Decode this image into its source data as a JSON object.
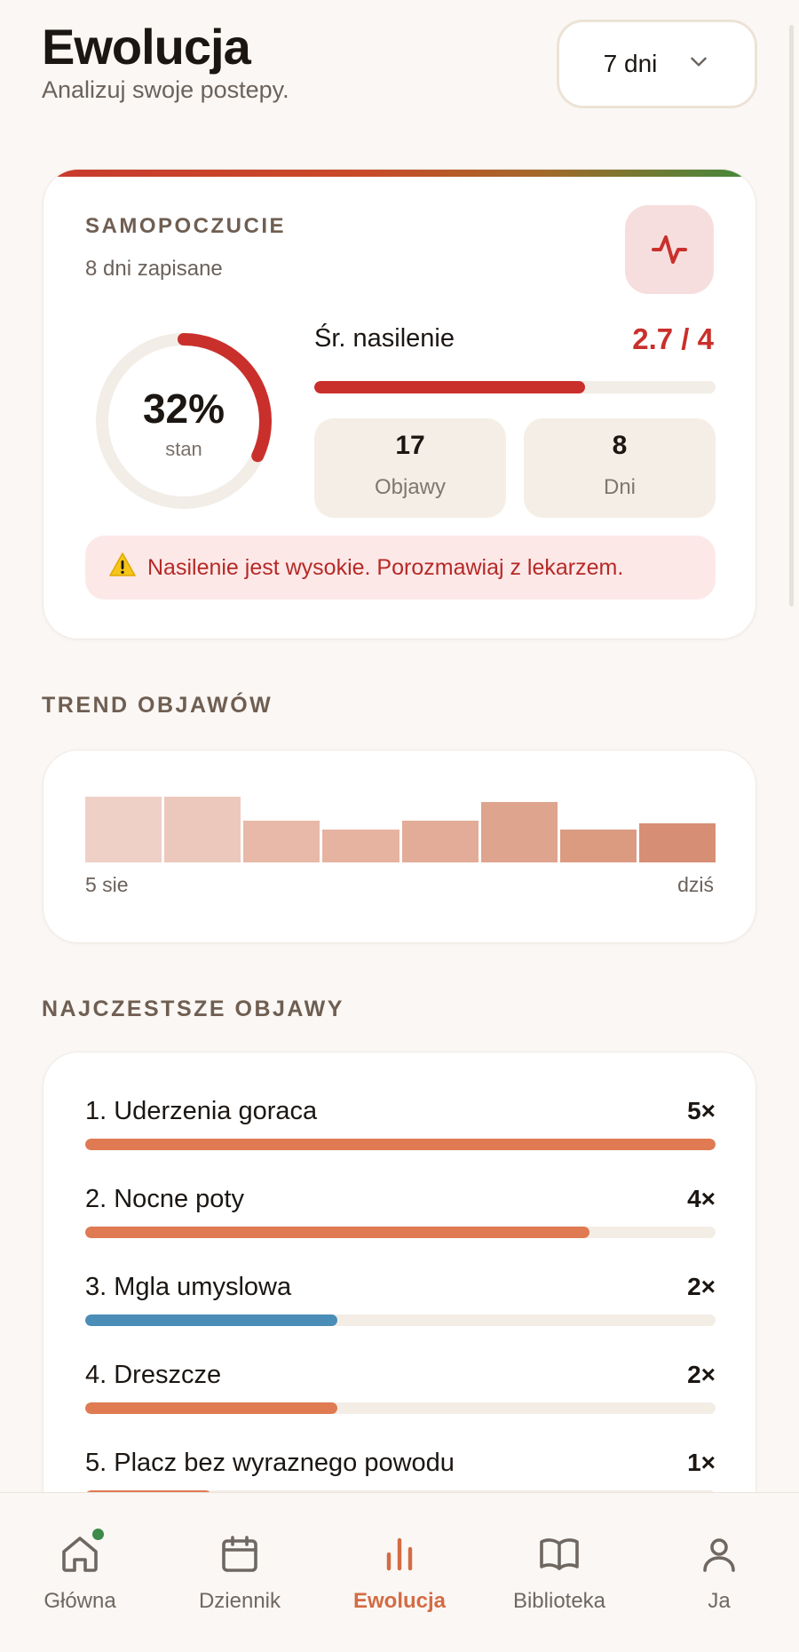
{
  "header": {
    "title": "Ewolucja",
    "subtitle": "Analizuj swoje postepy.",
    "range_select": "7 dni"
  },
  "wellbeing": {
    "label": "SAMOPOCZUCIE",
    "days_saved": "8 dni zapisane",
    "ring_value": "32%",
    "ring_fraction": 0.32,
    "ring_caption": "stan",
    "severity_label": "Śr. nasilenie",
    "severity_value": "2.7 / 4",
    "severity_fraction": 0.675,
    "stats": [
      {
        "value": "17",
        "label": "Objawy"
      },
      {
        "value": "8",
        "label": "Dni"
      }
    ],
    "alert": "Nasilenie jest wysokie. Porozmawiaj z lekarzem.",
    "colors": {
      "severity": "#c9302c",
      "ring": "#c9302c",
      "alert_bg": "#fde8e8"
    }
  },
  "trend": {
    "label": "TREND OBJAWÓW",
    "start_label": "5 sie",
    "end_label": "dziś",
    "bars": [
      {
        "value": 0.82,
        "color": "#efd0c6"
      },
      {
        "value": 0.82,
        "color": "#ecc8bc"
      },
      {
        "value": 0.52,
        "color": "#e8b9a8"
      },
      {
        "value": 0.41,
        "color": "#e6b3a1"
      },
      {
        "value": 0.52,
        "color": "#e2ac98"
      },
      {
        "value": 0.76,
        "color": "#dea48d"
      },
      {
        "value": 0.41,
        "color": "#db9b81"
      },
      {
        "value": 0.49,
        "color": "#d68f74"
      }
    ]
  },
  "top_symptoms": {
    "label": "NAJCZESTSZE OBJAWY",
    "items": [
      {
        "name": "1. Uderzenia goraca",
        "count": "5×",
        "fraction": 1.0,
        "color": "#df7a52"
      },
      {
        "name": "2. Nocne poty",
        "count": "4×",
        "fraction": 0.8,
        "color": "#df7a52"
      },
      {
        "name": "3. Mgla umyslowa",
        "count": "2×",
        "fraction": 0.4,
        "color": "#4a8db7"
      },
      {
        "name": "4. Dreszcze",
        "count": "2×",
        "fraction": 0.4,
        "color": "#df7a52"
      },
      {
        "name": "5. Placz bez wyraznego powodu",
        "count": "1×",
        "fraction": 0.2,
        "color": "#df7a52"
      }
    ]
  },
  "nav": {
    "items": [
      {
        "label": "Główna",
        "icon": "home-icon",
        "active": false,
        "dot": true
      },
      {
        "label": "Dziennik",
        "icon": "calendar-icon",
        "active": false
      },
      {
        "label": "Ewolucja",
        "icon": "chart-bars-icon",
        "active": true
      },
      {
        "label": "Biblioteka",
        "icon": "book-icon",
        "active": false
      },
      {
        "label": "Ja",
        "icon": "user-icon",
        "active": false
      }
    ],
    "colors": {
      "active": "#d36c44",
      "inactive": "#6f6761",
      "dot": "#3e8a4a"
    }
  }
}
